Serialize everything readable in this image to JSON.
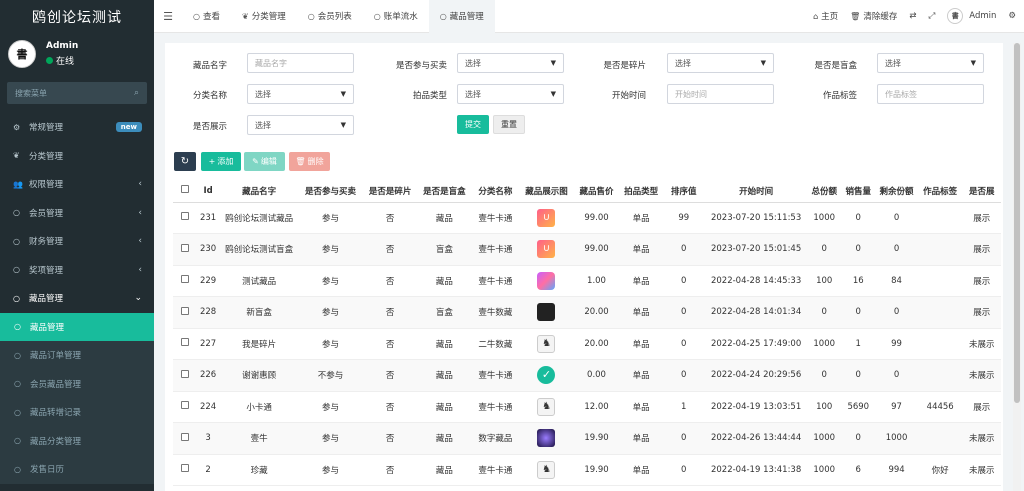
{
  "app": {
    "title": "鸥创论坛测试"
  },
  "user": {
    "name": "Admin",
    "status": "在线",
    "avatar_text": "書"
  },
  "sidebar": {
    "search_placeholder": "搜索菜单",
    "items": [
      {
        "label": "常规管理",
        "icon": "cogs-icon",
        "badge": "new"
      },
      {
        "label": "分类管理",
        "icon": "leaf-icon"
      },
      {
        "label": "权限管理",
        "icon": "group-icon",
        "arrow": "‹"
      },
      {
        "label": "会员管理",
        "icon": "circle-icon",
        "arrow": "‹"
      },
      {
        "label": "财务管理",
        "icon": "circle-icon",
        "arrow": "‹"
      },
      {
        "label": "奖项管理",
        "icon": "circle-icon",
        "arrow": "‹"
      },
      {
        "label": "藏品管理",
        "icon": "circle-icon",
        "arrow": "⌄"
      }
    ],
    "subitems": [
      {
        "label": "藏品管理",
        "active": true
      },
      {
        "label": "藏品订单管理"
      },
      {
        "label": "会员藏品管理"
      },
      {
        "label": "藏品转增记录"
      },
      {
        "label": "藏品分类管理"
      },
      {
        "label": "发售日历"
      }
    ]
  },
  "topbar": {
    "tabs": [
      {
        "label": "查看"
      },
      {
        "label": "分类管理"
      },
      {
        "label": "会员列表"
      },
      {
        "label": "账单流水"
      },
      {
        "label": "藏品管理",
        "active": true
      }
    ],
    "home": "主页",
    "clear_cache": "清除缓存",
    "admin": "Admin"
  },
  "filters": {
    "name_label": "藏品名字",
    "name_placeholder": "藏品名字",
    "buysell_label": "是否参与买卖",
    "buysell_value": "选择",
    "fragment_label": "是否是碎片",
    "fragment_value": "选择",
    "blindbox_label": "是否是盲盒",
    "blindbox_value": "选择",
    "category_label": "分类名称",
    "category_value": "选择",
    "auction_label": "拍品类型",
    "auction_value": "选择",
    "start_label": "开始时间",
    "start_placeholder": "开始时间",
    "tag_label": "作品标签",
    "tag_placeholder": "作品标签",
    "show_label": "是否展示",
    "show_value": "选择",
    "submit": "提交",
    "reset": "重置"
  },
  "toolbar": {
    "add": "添加",
    "edit": "编辑",
    "delete": "删除"
  },
  "table": {
    "headers": [
      "Id",
      "藏品名字",
      "是否参与买卖",
      "是否是碎片",
      "是否是盲盒",
      "分类名称",
      "藏品展示图",
      "藏品售价",
      "拍品类型",
      "排序值",
      "开始时间",
      "总份额",
      "销售量",
      "剩余份额",
      "作品标签",
      "是否展"
    ],
    "rows": [
      {
        "id": "231",
        "name": "鸥创论坛测试藏品",
        "buysell": "参与",
        "fragment": "否",
        "blindbox": "藏品",
        "category": "壹牛卡通",
        "thumb": "logo",
        "price": "99.00",
        "type": "单品",
        "sort": "99",
        "start": "2023-07-20 15:11:53",
        "total": "1000",
        "sold": "0",
        "remain": "0",
        "tag": "",
        "show": "展示"
      },
      {
        "id": "230",
        "name": "鸥创论坛测试盲盒",
        "buysell": "参与",
        "fragment": "否",
        "blindbox": "盲盒",
        "category": "壹牛卡通",
        "thumb": "logo",
        "price": "99.00",
        "type": "单品",
        "sort": "0",
        "start": "2023-07-20 15:01:45",
        "total": "0",
        "sold": "0",
        "remain": "0",
        "tag": "",
        "show": "展示"
      },
      {
        "id": "229",
        "name": "测试藏品",
        "buysell": "参与",
        "fragment": "否",
        "blindbox": "藏品",
        "category": "壹牛卡通",
        "thumb": "poly",
        "price": "1.00",
        "type": "单品",
        "sort": "0",
        "start": "2022-04-28 14:45:33",
        "total": "100",
        "sold": "16",
        "remain": "84",
        "tag": "",
        "show": "展示"
      },
      {
        "id": "228",
        "name": "新盲盒",
        "buysell": "参与",
        "fragment": "否",
        "blindbox": "盲盒",
        "category": "壹牛数藏",
        "thumb": "dark",
        "price": "20.00",
        "type": "单品",
        "sort": "0",
        "start": "2022-04-28 14:01:34",
        "total": "0",
        "sold": "0",
        "remain": "0",
        "tag": "",
        "show": "展示"
      },
      {
        "id": "227",
        "name": "我是碎片",
        "buysell": "参与",
        "fragment": "否",
        "blindbox": "藏品",
        "category": "二牛数藏",
        "thumb": "sketch",
        "price": "20.00",
        "type": "单品",
        "sort": "0",
        "start": "2022-04-25 17:49:00",
        "total": "1000",
        "sold": "1",
        "remain": "99",
        "tag": "",
        "show": "未展示"
      },
      {
        "id": "226",
        "name": "谢谢惠顾",
        "buysell": "不参与",
        "fragment": "否",
        "blindbox": "藏品",
        "category": "壹牛卡通",
        "thumb": "check",
        "price": "0.00",
        "type": "单品",
        "sort": "0",
        "start": "2022-04-24 20:29:56",
        "total": "0",
        "sold": "0",
        "remain": "0",
        "tag": "",
        "show": "未展示"
      },
      {
        "id": "224",
        "name": "小卡通",
        "buysell": "参与",
        "fragment": "否",
        "blindbox": "藏品",
        "category": "壹牛卡通",
        "thumb": "sketch",
        "price": "12.00",
        "type": "单品",
        "sort": "1",
        "start": "2022-04-19 13:03:51",
        "total": "100",
        "sold": "5690",
        "remain": "97",
        "tag": "44456",
        "show": "展示"
      },
      {
        "id": "3",
        "name": "壹牛",
        "buysell": "参与",
        "fragment": "否",
        "blindbox": "藏品",
        "category": "数字藏品",
        "thumb": "purple",
        "price": "19.90",
        "type": "单品",
        "sort": "0",
        "start": "2022-04-26 13:44:44",
        "total": "1000",
        "sold": "0",
        "remain": "1000",
        "tag": "",
        "show": "未展示"
      },
      {
        "id": "2",
        "name": "珍藏",
        "buysell": "参与",
        "fragment": "否",
        "blindbox": "藏品",
        "category": "壹牛卡通",
        "thumb": "sketch",
        "price": "19.90",
        "type": "单品",
        "sort": "0",
        "start": "2022-04-19 13:41:38",
        "total": "1000",
        "sold": "6",
        "remain": "994",
        "tag": "你好",
        "show": "未展示"
      }
    ]
  },
  "colors": {
    "accent": "#18bc9c",
    "sidebar": "#222d32",
    "badge": "#3c8dbc",
    "delete": "#e74c3c",
    "refresh": "#2c3e50"
  }
}
